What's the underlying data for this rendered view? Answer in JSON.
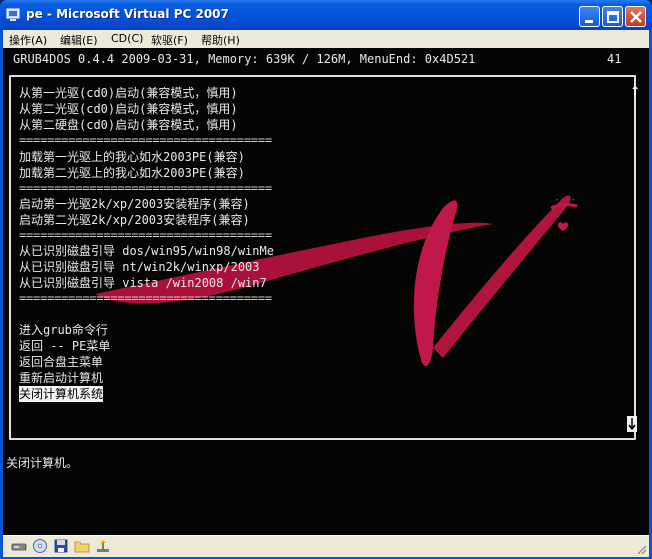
{
  "window": {
    "title": "pe - Microsoft Virtual PC 2007",
    "minimize_glyph": "minimize-icon",
    "maximize_glyph": "maximize-icon",
    "close_glyph": "close-icon"
  },
  "menubar": {
    "items": [
      {
        "label": "操作(A)"
      },
      {
        "label": "编辑(E)"
      },
      {
        "label": "CD(C)"
      },
      {
        "label": "软驱(F)"
      },
      {
        "label": "帮助(H)"
      }
    ]
  },
  "grub": {
    "header": "GRUB4DOS 0.4.4 2009-03-31, Memory: 639K / 126M, MenuEnd: 0x4D521",
    "countdown": "41",
    "entries": [
      "从第一光驱(cd0)启动(兼容模式，慎用)",
      "从第二光驱(cd0)启动(兼容模式，慎用)",
      "从第二硬盘(cd0)启动(兼容模式，慎用)",
      "====================================",
      "加载第一光驱上的我心如水2003PE(兼容)",
      "加载第二光驱上的我心如水2003PE(兼容)",
      "====================================",
      "启动第一光驱2k/xp/2003安装程序(兼容)",
      "启动第二光驱2k/xp/2003安装程序(兼容)",
      "====================================",
      "从已识别磁盘引导 dos/win95/win98/winMe",
      "从已识别磁盘引导 nt/win2k/winxp/2003",
      "从已识别磁盘引导 vista /win2008 /win7",
      "====================================",
      "",
      "进入grub命令行",
      "返回 -- PE菜单",
      "返回合盘主菜单",
      "重新启动计算机",
      "关闭计算机系统"
    ],
    "selected_index": 19,
    "scroll_up": "↑",
    "status_line": "关闭计算机。"
  },
  "colors": {
    "titlebar": "#0651d8",
    "screen_bg": "#050505",
    "text": "#e8e8e8",
    "accent_art": "#c0184a"
  },
  "statusbar": {
    "icons": [
      "harddisk-icon",
      "cd-icon",
      "floppy-icon",
      "shared-folder-icon",
      "network-icon"
    ]
  }
}
